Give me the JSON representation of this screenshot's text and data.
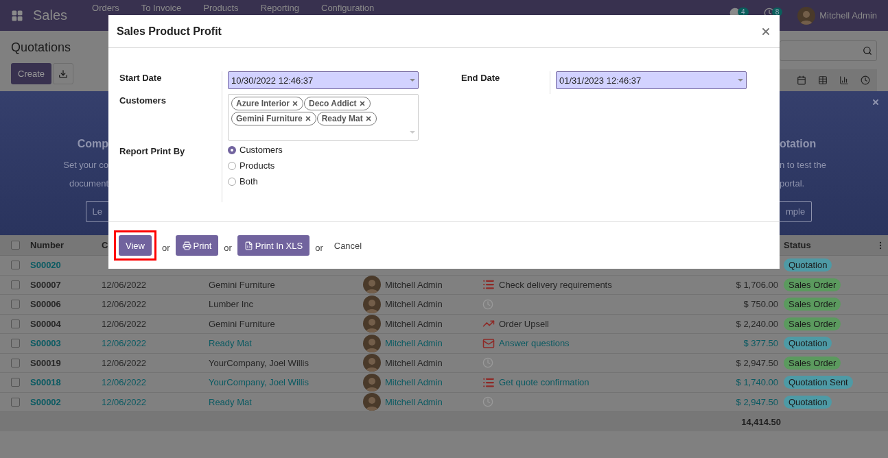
{
  "navbar": {
    "app_name": "Sales",
    "menu": [
      "Orders",
      "To Invoice",
      "Products",
      "Reporting",
      "Configuration"
    ],
    "messages_badge": "4",
    "activities_badge": "8",
    "user": "Mitchell Admin"
  },
  "control_panel": {
    "title": "Quotations",
    "create_button": "Create"
  },
  "banner": {
    "left": {
      "title": "Comp",
      "lines": [
        "Set your co",
        "document"
      ],
      "button": "Le"
    },
    "right": {
      "title": "otation",
      "lines": [
        "n to test the",
        "portal."
      ],
      "button": "mple"
    }
  },
  "table": {
    "select_all": {
      "checked": false
    },
    "columns": [
      "Number",
      "C",
      "Status"
    ],
    "rows": [
      {
        "checked": false,
        "number": "S00020",
        "activity": {
          "kind": "hidden"
        },
        "status": {
          "label": "Quotation",
          "color": "#4e9aa5"
        },
        "accent": true
      },
      {
        "checked": false,
        "number": "S00007",
        "date": "12/06/2022",
        "customer": "Gemini Furniture",
        "salesperson": "Mitchell Admin",
        "activity": {
          "kind": "list",
          "text": "Check delivery requirements"
        },
        "total": "$ 1,706.00",
        "status": {
          "label": "Sales Order",
          "color": "#5b9a5e"
        },
        "accent": false
      },
      {
        "checked": false,
        "number": "S00006",
        "date": "12/06/2022",
        "customer": "Lumber Inc",
        "salesperson": "Mitchell Admin",
        "activity": {
          "kind": "none"
        },
        "total": "$ 750.00",
        "status": {
          "label": "Sales Order",
          "color": "#5b9a5e"
        },
        "accent": false
      },
      {
        "checked": false,
        "number": "S00004",
        "date": "12/06/2022",
        "customer": "Gemini Furniture",
        "salesperson": "Mitchell Admin",
        "activity": {
          "kind": "upsell",
          "text": "Order Upsell"
        },
        "total": "$ 2,240.00",
        "status": {
          "label": "Sales Order",
          "color": "#5b9a5e"
        },
        "accent": false
      },
      {
        "checked": false,
        "number": "S00003",
        "date": "12/06/2022",
        "customer": "Ready Mat",
        "salesperson": "Mitchell Admin",
        "activity": {
          "kind": "email",
          "text": "Answer questions"
        },
        "total": "$ 377.50",
        "status": {
          "label": "Quotation",
          "color": "#4e9aa5"
        },
        "accent": true
      },
      {
        "checked": false,
        "number": "S00019",
        "date": "12/06/2022",
        "customer": "YourCompany, Joel Willis",
        "salesperson": "Mitchell Admin",
        "activity": {
          "kind": "none"
        },
        "total": "$ 2,947.50",
        "status": {
          "label": "Sales Order",
          "color": "#5b9a5e"
        },
        "accent": false
      },
      {
        "checked": false,
        "number": "S00018",
        "date": "12/06/2022",
        "customer": "YourCompany, Joel Willis",
        "salesperson": "Mitchell Admin",
        "activity": {
          "kind": "list",
          "text": "Get quote confirmation"
        },
        "total": "$ 1,740.00",
        "status": {
          "label": "Quotation Sent",
          "color": "#4e9aa5"
        },
        "accent": true
      },
      {
        "checked": false,
        "number": "S00002",
        "date": "12/06/2022",
        "customer": "Ready Mat",
        "salesperson": "Mitchell Admin",
        "activity": {
          "kind": "none"
        },
        "total": "$ 2,947.50",
        "status": {
          "label": "Quotation",
          "color": "#4e9aa5"
        },
        "accent": true
      }
    ],
    "sum": "14,414.50"
  },
  "dialog": {
    "title": "Sales Product Profit",
    "start_date": {
      "label": "Start Date",
      "value": "10/30/2022 12:46:37"
    },
    "end_date": {
      "label": "End Date",
      "value": "01/31/2023 12:46:37"
    },
    "customers": {
      "label": "Customers",
      "tags": [
        "Azure Interior",
        "Deco Addict",
        "Gemini Furniture",
        "Ready Mat"
      ]
    },
    "print_by": {
      "label": "Report Print By",
      "options": [
        {
          "label": "Customers",
          "selected": true
        },
        {
          "label": "Products",
          "selected": false
        },
        {
          "label": "Both",
          "selected": false
        }
      ]
    },
    "footer": [
      {
        "kind": "view",
        "label": "View",
        "highlighted": true
      },
      {
        "kind": "or",
        "label": "or"
      },
      {
        "kind": "print",
        "label": "Print",
        "highlighted": false
      },
      {
        "kind": "or",
        "label": "or"
      },
      {
        "kind": "spreadsheet",
        "label": "Print In XLS",
        "highlighted": false
      },
      {
        "kind": "or",
        "label": "or"
      },
      {
        "kind": "cancel",
        "label": "Cancel"
      }
    ]
  }
}
